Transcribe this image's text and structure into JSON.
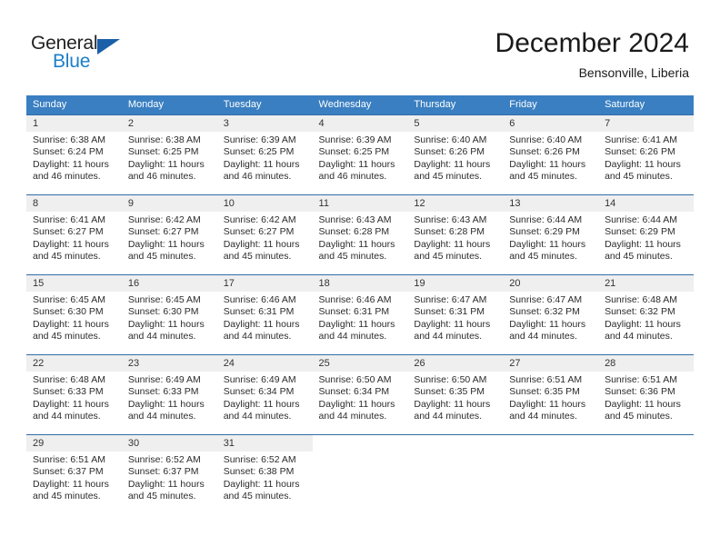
{
  "brand": {
    "name_top": "General",
    "name_bottom": "Blue",
    "triangle_color": "#1a5fa8",
    "blue_color": "#1a7ec8"
  },
  "header": {
    "title": "December 2024",
    "subtitle": "Bensonville, Liberia"
  },
  "theme": {
    "header_bg": "#3a7fc1",
    "header_text": "#ffffff",
    "daynum_bg": "#efefef",
    "cell_border": "#2f6ea8",
    "body_text": "#2b2b2b"
  },
  "weekdays": [
    "Sunday",
    "Monday",
    "Tuesday",
    "Wednesday",
    "Thursday",
    "Friday",
    "Saturday"
  ],
  "labels": {
    "sunrise_prefix": "Sunrise:",
    "sunset_prefix": "Sunset:",
    "daylight_prefix": "Daylight:"
  },
  "weeks": [
    [
      {
        "day": "1",
        "sunrise": "Sunrise: 6:38 AM",
        "sunset": "Sunset: 6:24 PM",
        "daylight_line1": "Daylight: 11 hours",
        "daylight_line2": "and 46 minutes."
      },
      {
        "day": "2",
        "sunrise": "Sunrise: 6:38 AM",
        "sunset": "Sunset: 6:25 PM",
        "daylight_line1": "Daylight: 11 hours",
        "daylight_line2": "and 46 minutes."
      },
      {
        "day": "3",
        "sunrise": "Sunrise: 6:39 AM",
        "sunset": "Sunset: 6:25 PM",
        "daylight_line1": "Daylight: 11 hours",
        "daylight_line2": "and 46 minutes."
      },
      {
        "day": "4",
        "sunrise": "Sunrise: 6:39 AM",
        "sunset": "Sunset: 6:25 PM",
        "daylight_line1": "Daylight: 11 hours",
        "daylight_line2": "and 46 minutes."
      },
      {
        "day": "5",
        "sunrise": "Sunrise: 6:40 AM",
        "sunset": "Sunset: 6:26 PM",
        "daylight_line1": "Daylight: 11 hours",
        "daylight_line2": "and 45 minutes."
      },
      {
        "day": "6",
        "sunrise": "Sunrise: 6:40 AM",
        "sunset": "Sunset: 6:26 PM",
        "daylight_line1": "Daylight: 11 hours",
        "daylight_line2": "and 45 minutes."
      },
      {
        "day": "7",
        "sunrise": "Sunrise: 6:41 AM",
        "sunset": "Sunset: 6:26 PM",
        "daylight_line1": "Daylight: 11 hours",
        "daylight_line2": "and 45 minutes."
      }
    ],
    [
      {
        "day": "8",
        "sunrise": "Sunrise: 6:41 AM",
        "sunset": "Sunset: 6:27 PM",
        "daylight_line1": "Daylight: 11 hours",
        "daylight_line2": "and 45 minutes."
      },
      {
        "day": "9",
        "sunrise": "Sunrise: 6:42 AM",
        "sunset": "Sunset: 6:27 PM",
        "daylight_line1": "Daylight: 11 hours",
        "daylight_line2": "and 45 minutes."
      },
      {
        "day": "10",
        "sunrise": "Sunrise: 6:42 AM",
        "sunset": "Sunset: 6:27 PM",
        "daylight_line1": "Daylight: 11 hours",
        "daylight_line2": "and 45 minutes."
      },
      {
        "day": "11",
        "sunrise": "Sunrise: 6:43 AM",
        "sunset": "Sunset: 6:28 PM",
        "daylight_line1": "Daylight: 11 hours",
        "daylight_line2": "and 45 minutes."
      },
      {
        "day": "12",
        "sunrise": "Sunrise: 6:43 AM",
        "sunset": "Sunset: 6:28 PM",
        "daylight_line1": "Daylight: 11 hours",
        "daylight_line2": "and 45 minutes."
      },
      {
        "day": "13",
        "sunrise": "Sunrise: 6:44 AM",
        "sunset": "Sunset: 6:29 PM",
        "daylight_line1": "Daylight: 11 hours",
        "daylight_line2": "and 45 minutes."
      },
      {
        "day": "14",
        "sunrise": "Sunrise: 6:44 AM",
        "sunset": "Sunset: 6:29 PM",
        "daylight_line1": "Daylight: 11 hours",
        "daylight_line2": "and 45 minutes."
      }
    ],
    [
      {
        "day": "15",
        "sunrise": "Sunrise: 6:45 AM",
        "sunset": "Sunset: 6:30 PM",
        "daylight_line1": "Daylight: 11 hours",
        "daylight_line2": "and 45 minutes."
      },
      {
        "day": "16",
        "sunrise": "Sunrise: 6:45 AM",
        "sunset": "Sunset: 6:30 PM",
        "daylight_line1": "Daylight: 11 hours",
        "daylight_line2": "and 44 minutes."
      },
      {
        "day": "17",
        "sunrise": "Sunrise: 6:46 AM",
        "sunset": "Sunset: 6:31 PM",
        "daylight_line1": "Daylight: 11 hours",
        "daylight_line2": "and 44 minutes."
      },
      {
        "day": "18",
        "sunrise": "Sunrise: 6:46 AM",
        "sunset": "Sunset: 6:31 PM",
        "daylight_line1": "Daylight: 11 hours",
        "daylight_line2": "and 44 minutes."
      },
      {
        "day": "19",
        "sunrise": "Sunrise: 6:47 AM",
        "sunset": "Sunset: 6:31 PM",
        "daylight_line1": "Daylight: 11 hours",
        "daylight_line2": "and 44 minutes."
      },
      {
        "day": "20",
        "sunrise": "Sunrise: 6:47 AM",
        "sunset": "Sunset: 6:32 PM",
        "daylight_line1": "Daylight: 11 hours",
        "daylight_line2": "and 44 minutes."
      },
      {
        "day": "21",
        "sunrise": "Sunrise: 6:48 AM",
        "sunset": "Sunset: 6:32 PM",
        "daylight_line1": "Daylight: 11 hours",
        "daylight_line2": "and 44 minutes."
      }
    ],
    [
      {
        "day": "22",
        "sunrise": "Sunrise: 6:48 AM",
        "sunset": "Sunset: 6:33 PM",
        "daylight_line1": "Daylight: 11 hours",
        "daylight_line2": "and 44 minutes."
      },
      {
        "day": "23",
        "sunrise": "Sunrise: 6:49 AM",
        "sunset": "Sunset: 6:33 PM",
        "daylight_line1": "Daylight: 11 hours",
        "daylight_line2": "and 44 minutes."
      },
      {
        "day": "24",
        "sunrise": "Sunrise: 6:49 AM",
        "sunset": "Sunset: 6:34 PM",
        "daylight_line1": "Daylight: 11 hours",
        "daylight_line2": "and 44 minutes."
      },
      {
        "day": "25",
        "sunrise": "Sunrise: 6:50 AM",
        "sunset": "Sunset: 6:34 PM",
        "daylight_line1": "Daylight: 11 hours",
        "daylight_line2": "and 44 minutes."
      },
      {
        "day": "26",
        "sunrise": "Sunrise: 6:50 AM",
        "sunset": "Sunset: 6:35 PM",
        "daylight_line1": "Daylight: 11 hours",
        "daylight_line2": "and 44 minutes."
      },
      {
        "day": "27",
        "sunrise": "Sunrise: 6:51 AM",
        "sunset": "Sunset: 6:35 PM",
        "daylight_line1": "Daylight: 11 hours",
        "daylight_line2": "and 44 minutes."
      },
      {
        "day": "28",
        "sunrise": "Sunrise: 6:51 AM",
        "sunset": "Sunset: 6:36 PM",
        "daylight_line1": "Daylight: 11 hours",
        "daylight_line2": "and 45 minutes."
      }
    ],
    [
      {
        "day": "29",
        "sunrise": "Sunrise: 6:51 AM",
        "sunset": "Sunset: 6:37 PM",
        "daylight_line1": "Daylight: 11 hours",
        "daylight_line2": "and 45 minutes."
      },
      {
        "day": "30",
        "sunrise": "Sunrise: 6:52 AM",
        "sunset": "Sunset: 6:37 PM",
        "daylight_line1": "Daylight: 11 hours",
        "daylight_line2": "and 45 minutes."
      },
      {
        "day": "31",
        "sunrise": "Sunrise: 6:52 AM",
        "sunset": "Sunset: 6:38 PM",
        "daylight_line1": "Daylight: 11 hours",
        "daylight_line2": "and 45 minutes."
      },
      {
        "day": "",
        "sunrise": "",
        "sunset": "",
        "daylight_line1": "",
        "daylight_line2": ""
      },
      {
        "day": "",
        "sunrise": "",
        "sunset": "",
        "daylight_line1": "",
        "daylight_line2": ""
      },
      {
        "day": "",
        "sunrise": "",
        "sunset": "",
        "daylight_line1": "",
        "daylight_line2": ""
      },
      {
        "day": "",
        "sunrise": "",
        "sunset": "",
        "daylight_line1": "",
        "daylight_line2": ""
      }
    ]
  ]
}
